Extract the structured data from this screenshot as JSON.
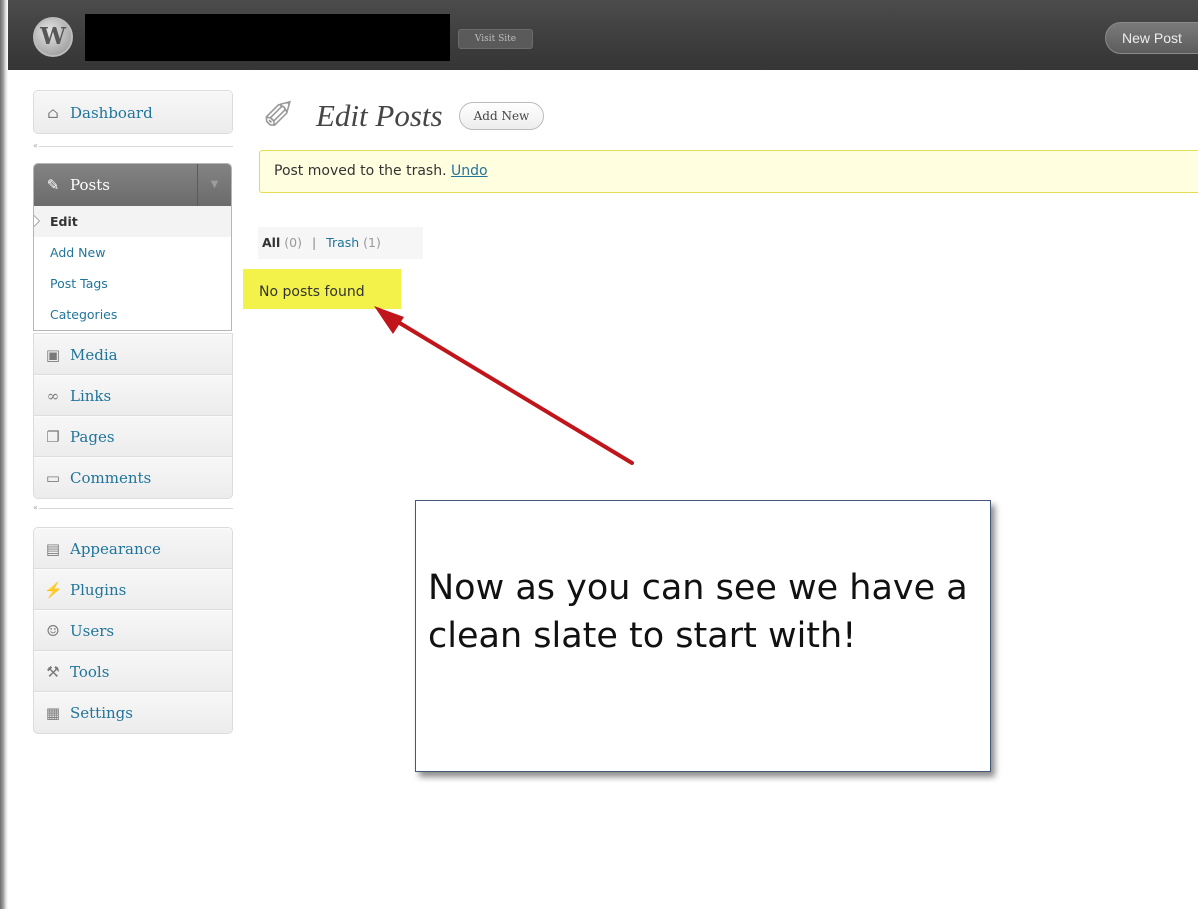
{
  "header": {
    "logo_letter": "W",
    "visit_site_label": "Visit Site",
    "new_post_label": "New Post"
  },
  "sidebar": {
    "dashboard": {
      "label": "Dashboard",
      "icon": "home-icon"
    },
    "posts": {
      "label": "Posts",
      "icon": "pin-icon",
      "toggle": "▼",
      "submenu": [
        "Edit",
        "Add New",
        "Post Tags",
        "Categories"
      ],
      "current": "Edit"
    },
    "group_content": [
      {
        "label": "Media",
        "icon": "media-icon"
      },
      {
        "label": "Links",
        "icon": "link-icon"
      },
      {
        "label": "Pages",
        "icon": "pages-icon"
      },
      {
        "label": "Comments",
        "icon": "comments-icon"
      }
    ],
    "group_admin": [
      {
        "label": "Appearance",
        "icon": "appearance-icon"
      },
      {
        "label": "Plugins",
        "icon": "plugin-icon"
      },
      {
        "label": "Users",
        "icon": "users-icon"
      },
      {
        "label": "Tools",
        "icon": "tools-icon"
      },
      {
        "label": "Settings",
        "icon": "settings-icon"
      }
    ]
  },
  "main": {
    "title": "Edit Posts",
    "add_new_label": "Add New",
    "notice": {
      "text": "Post moved to the trash.",
      "undo_label": "Undo"
    },
    "filters": {
      "all_label": "All",
      "all_count": "(0)",
      "separator": "|",
      "trash_label": "Trash",
      "trash_count": "(1)"
    },
    "empty_message": "No posts found"
  },
  "annotation": {
    "callout_text": "Now as you can see we have a clean slate to start with!",
    "arrow_color": "#c0151b"
  }
}
